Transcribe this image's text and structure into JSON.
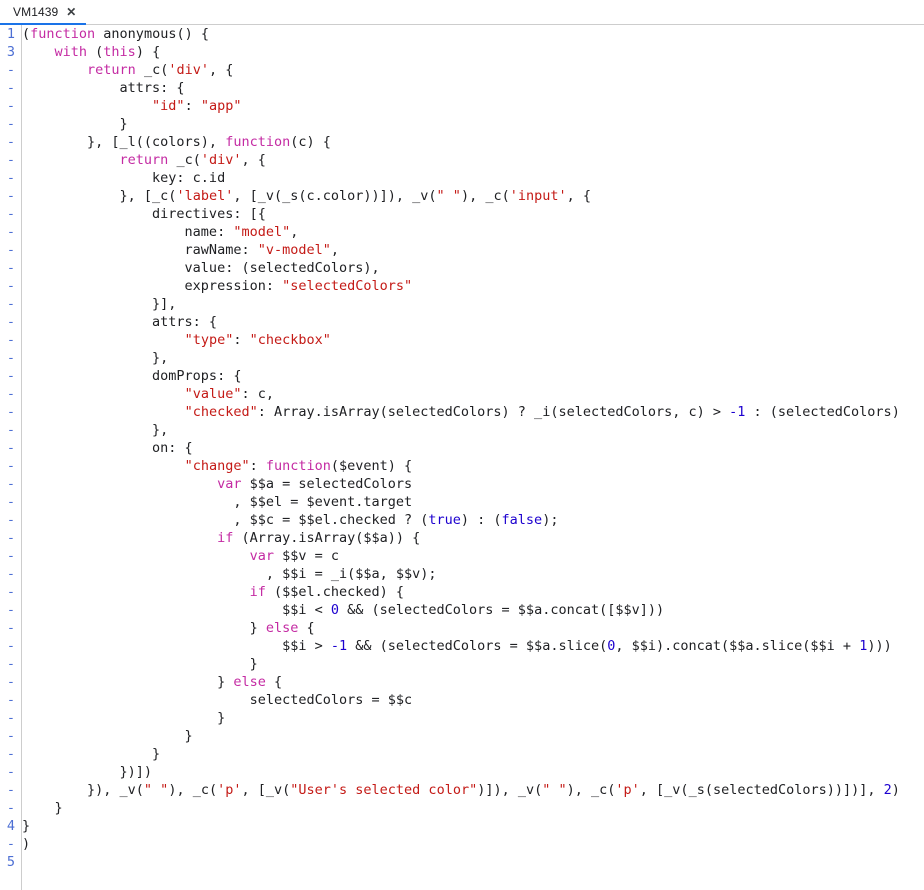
{
  "tabstrip": {
    "tabs": [
      {
        "label": "VM1439",
        "close_icon": "close-icon",
        "close_glyph": "✕",
        "active": true
      }
    ]
  },
  "editor": {
    "accent_color": "#1a73e8",
    "keyword_color": "#c42ba3",
    "string_color": "#c41a16",
    "number_color": "#1c00cf",
    "plain_color": "#202124",
    "linenumber_color": "#4d6fd4",
    "lines": [
      {
        "num": "1",
        "tokens": [
          {
            "t": "(",
            "c": "pln"
          },
          {
            "t": "function",
            "c": "kw"
          },
          {
            "t": " anonymous() {",
            "c": "pln"
          }
        ]
      },
      {
        "num": "3",
        "tokens": [
          {
            "t": "    ",
            "c": "pln"
          },
          {
            "t": "with",
            "c": "kw"
          },
          {
            "t": " (",
            "c": "pln"
          },
          {
            "t": "this",
            "c": "kw"
          },
          {
            "t": ") {",
            "c": "pln"
          }
        ]
      },
      {
        "num": "-",
        "tokens": [
          {
            "t": "        ",
            "c": "pln"
          },
          {
            "t": "return",
            "c": "kw"
          },
          {
            "t": " _c(",
            "c": "pln"
          },
          {
            "t": "'div'",
            "c": "str"
          },
          {
            "t": ", {",
            "c": "pln"
          }
        ]
      },
      {
        "num": "-",
        "tokens": [
          {
            "t": "            attrs: {",
            "c": "pln"
          }
        ]
      },
      {
        "num": "-",
        "tokens": [
          {
            "t": "                ",
            "c": "pln"
          },
          {
            "t": "\"id\"",
            "c": "str"
          },
          {
            "t": ": ",
            "c": "pln"
          },
          {
            "t": "\"app\"",
            "c": "str"
          }
        ]
      },
      {
        "num": "-",
        "tokens": [
          {
            "t": "            }",
            "c": "pln"
          }
        ]
      },
      {
        "num": "-",
        "tokens": [
          {
            "t": "        }, [_l((colors), ",
            "c": "pln"
          },
          {
            "t": "function",
            "c": "kw"
          },
          {
            "t": "(c) {",
            "c": "pln"
          }
        ]
      },
      {
        "num": "-",
        "tokens": [
          {
            "t": "            ",
            "c": "pln"
          },
          {
            "t": "return",
            "c": "kw"
          },
          {
            "t": " _c(",
            "c": "pln"
          },
          {
            "t": "'div'",
            "c": "str"
          },
          {
            "t": ", {",
            "c": "pln"
          }
        ]
      },
      {
        "num": "-",
        "tokens": [
          {
            "t": "                key: c.id",
            "c": "pln"
          }
        ]
      },
      {
        "num": "-",
        "tokens": [
          {
            "t": "            }, [_c(",
            "c": "pln"
          },
          {
            "t": "'label'",
            "c": "str"
          },
          {
            "t": ", [_v(_s(c.color))]), _v(",
            "c": "pln"
          },
          {
            "t": "\" \"",
            "c": "str"
          },
          {
            "t": "), _c(",
            "c": "pln"
          },
          {
            "t": "'input'",
            "c": "str"
          },
          {
            "t": ", {",
            "c": "pln"
          }
        ]
      },
      {
        "num": "-",
        "tokens": [
          {
            "t": "                directives: [{",
            "c": "pln"
          }
        ]
      },
      {
        "num": "-",
        "tokens": [
          {
            "t": "                    name: ",
            "c": "pln"
          },
          {
            "t": "\"model\"",
            "c": "str"
          },
          {
            "t": ",",
            "c": "pln"
          }
        ]
      },
      {
        "num": "-",
        "tokens": [
          {
            "t": "                    rawName: ",
            "c": "pln"
          },
          {
            "t": "\"v-model\"",
            "c": "str"
          },
          {
            "t": ",",
            "c": "pln"
          }
        ]
      },
      {
        "num": "-",
        "tokens": [
          {
            "t": "                    value: (selectedColors),",
            "c": "pln"
          }
        ]
      },
      {
        "num": "-",
        "tokens": [
          {
            "t": "                    expression: ",
            "c": "pln"
          },
          {
            "t": "\"selectedColors\"",
            "c": "str"
          }
        ]
      },
      {
        "num": "-",
        "tokens": [
          {
            "t": "                }],",
            "c": "pln"
          }
        ]
      },
      {
        "num": "-",
        "tokens": [
          {
            "t": "                attrs: {",
            "c": "pln"
          }
        ]
      },
      {
        "num": "-",
        "tokens": [
          {
            "t": "                    ",
            "c": "pln"
          },
          {
            "t": "\"type\"",
            "c": "str"
          },
          {
            "t": ": ",
            "c": "pln"
          },
          {
            "t": "\"checkbox\"",
            "c": "str"
          }
        ]
      },
      {
        "num": "-",
        "tokens": [
          {
            "t": "                },",
            "c": "pln"
          }
        ]
      },
      {
        "num": "-",
        "tokens": [
          {
            "t": "                domProps: {",
            "c": "pln"
          }
        ]
      },
      {
        "num": "-",
        "tokens": [
          {
            "t": "                    ",
            "c": "pln"
          },
          {
            "t": "\"value\"",
            "c": "str"
          },
          {
            "t": ": c,",
            "c": "pln"
          }
        ]
      },
      {
        "num": "-",
        "tokens": [
          {
            "t": "                    ",
            "c": "pln"
          },
          {
            "t": "\"checked\"",
            "c": "str"
          },
          {
            "t": ": Array.isArray(selectedColors) ? _i(selectedColors, c) > ",
            "c": "pln"
          },
          {
            "t": "-1",
            "c": "num"
          },
          {
            "t": " : (selectedColors)",
            "c": "pln"
          }
        ]
      },
      {
        "num": "-",
        "tokens": [
          {
            "t": "                },",
            "c": "pln"
          }
        ]
      },
      {
        "num": "-",
        "tokens": [
          {
            "t": "                on: {",
            "c": "pln"
          }
        ]
      },
      {
        "num": "-",
        "tokens": [
          {
            "t": "                    ",
            "c": "pln"
          },
          {
            "t": "\"change\"",
            "c": "str"
          },
          {
            "t": ": ",
            "c": "pln"
          },
          {
            "t": "function",
            "c": "kw"
          },
          {
            "t": "($event) {",
            "c": "pln"
          }
        ]
      },
      {
        "num": "-",
        "tokens": [
          {
            "t": "                        ",
            "c": "pln"
          },
          {
            "t": "var",
            "c": "kw"
          },
          {
            "t": " $$a = selectedColors",
            "c": "pln"
          }
        ]
      },
      {
        "num": "-",
        "tokens": [
          {
            "t": "                          , $$el = $event.target",
            "c": "pln"
          }
        ]
      },
      {
        "num": "-",
        "tokens": [
          {
            "t": "                          , $$c = $$el.checked ? (",
            "c": "pln"
          },
          {
            "t": "true",
            "c": "num"
          },
          {
            "t": ") : (",
            "c": "pln"
          },
          {
            "t": "false",
            "c": "num"
          },
          {
            "t": ");",
            "c": "pln"
          }
        ]
      },
      {
        "num": "-",
        "tokens": [
          {
            "t": "                        ",
            "c": "pln"
          },
          {
            "t": "if",
            "c": "kw"
          },
          {
            "t": " (Array.isArray($$a)) {",
            "c": "pln"
          }
        ]
      },
      {
        "num": "-",
        "tokens": [
          {
            "t": "                            ",
            "c": "pln"
          },
          {
            "t": "var",
            "c": "kw"
          },
          {
            "t": " $$v = c",
            "c": "pln"
          }
        ]
      },
      {
        "num": "-",
        "tokens": [
          {
            "t": "                              , $$i = _i($$a, $$v);",
            "c": "pln"
          }
        ]
      },
      {
        "num": "-",
        "tokens": [
          {
            "t": "                            ",
            "c": "pln"
          },
          {
            "t": "if",
            "c": "kw"
          },
          {
            "t": " ($$el.checked) {",
            "c": "pln"
          }
        ]
      },
      {
        "num": "-",
        "tokens": [
          {
            "t": "                                $$i < ",
            "c": "pln"
          },
          {
            "t": "0",
            "c": "num"
          },
          {
            "t": " && (selectedColors = $$a.concat([$$v]))",
            "c": "pln"
          }
        ]
      },
      {
        "num": "-",
        "tokens": [
          {
            "t": "                            } ",
            "c": "pln"
          },
          {
            "t": "else",
            "c": "kw"
          },
          {
            "t": " {",
            "c": "pln"
          }
        ]
      },
      {
        "num": "-",
        "tokens": [
          {
            "t": "                                $$i > ",
            "c": "pln"
          },
          {
            "t": "-1",
            "c": "num"
          },
          {
            "t": " && (selectedColors = $$a.slice(",
            "c": "pln"
          },
          {
            "t": "0",
            "c": "num"
          },
          {
            "t": ", $$i).concat($$a.slice($$i + ",
            "c": "pln"
          },
          {
            "t": "1",
            "c": "num"
          },
          {
            "t": ")))",
            "c": "pln"
          }
        ]
      },
      {
        "num": "-",
        "tokens": [
          {
            "t": "                            }",
            "c": "pln"
          }
        ]
      },
      {
        "num": "-",
        "tokens": [
          {
            "t": "                        } ",
            "c": "pln"
          },
          {
            "t": "else",
            "c": "kw"
          },
          {
            "t": " {",
            "c": "pln"
          }
        ]
      },
      {
        "num": "-",
        "tokens": [
          {
            "t": "                            selectedColors = $$c",
            "c": "pln"
          }
        ]
      },
      {
        "num": "-",
        "tokens": [
          {
            "t": "                        }",
            "c": "pln"
          }
        ]
      },
      {
        "num": "-",
        "tokens": [
          {
            "t": "                    }",
            "c": "pln"
          }
        ]
      },
      {
        "num": "-",
        "tokens": [
          {
            "t": "                }",
            "c": "pln"
          }
        ]
      },
      {
        "num": "-",
        "tokens": [
          {
            "t": "            })])",
            "c": "pln"
          }
        ]
      },
      {
        "num": "-",
        "tokens": [
          {
            "t": "        }), _v(",
            "c": "pln"
          },
          {
            "t": "\" \"",
            "c": "str"
          },
          {
            "t": "), _c(",
            "c": "pln"
          },
          {
            "t": "'p'",
            "c": "str"
          },
          {
            "t": ", [_v(",
            "c": "pln"
          },
          {
            "t": "\"User's selected color\"",
            "c": "str"
          },
          {
            "t": ")]), _v(",
            "c": "pln"
          },
          {
            "t": "\" \"",
            "c": "str"
          },
          {
            "t": "), _c(",
            "c": "pln"
          },
          {
            "t": "'p'",
            "c": "str"
          },
          {
            "t": ", [_v(_s(selectedColors))])], ",
            "c": "pln"
          },
          {
            "t": "2",
            "c": "num"
          },
          {
            "t": ")",
            "c": "pln"
          }
        ]
      },
      {
        "num": "-",
        "tokens": [
          {
            "t": "    }",
            "c": "pln"
          }
        ]
      },
      {
        "num": "4",
        "tokens": [
          {
            "t": "}",
            "c": "pln"
          }
        ]
      },
      {
        "num": "-",
        "tokens": [
          {
            "t": ")",
            "c": "pln"
          }
        ]
      },
      {
        "num": "5",
        "tokens": [
          {
            "t": "",
            "c": "pln"
          }
        ]
      }
    ]
  }
}
